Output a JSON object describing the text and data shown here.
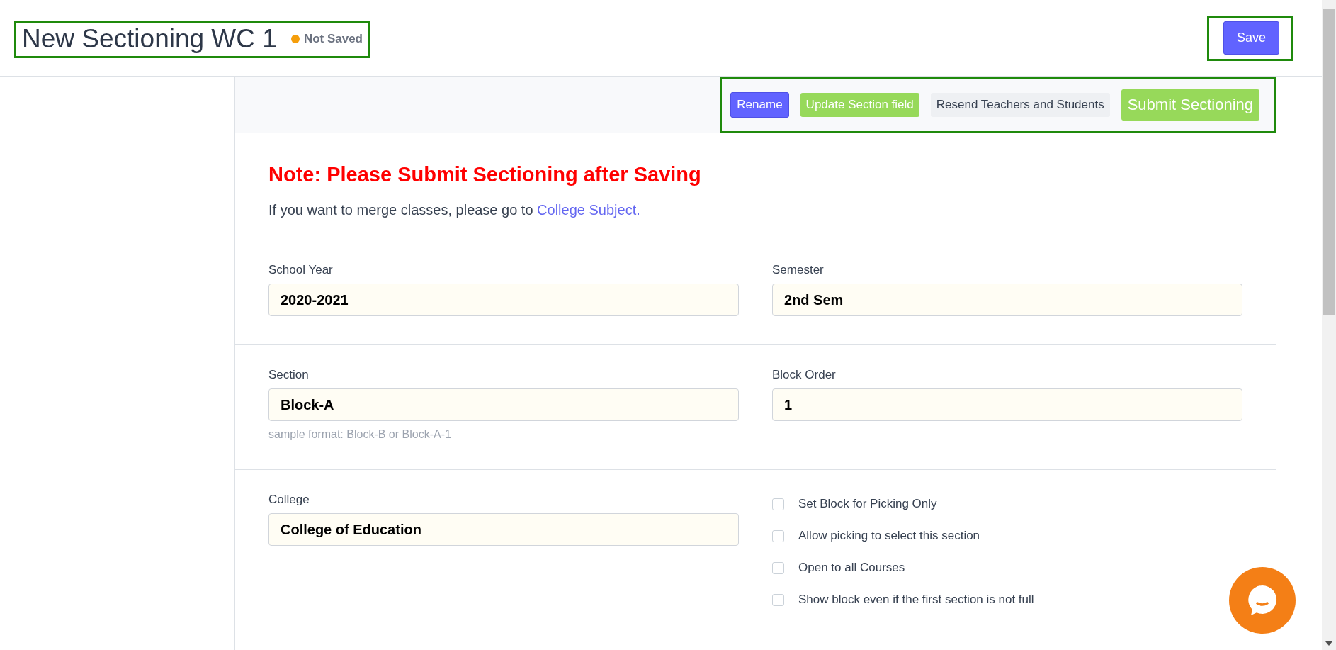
{
  "header": {
    "title": "New Sectioning WC 1",
    "status": {
      "label": "Not Saved",
      "color": "#f59e0b"
    },
    "save_button": "Save"
  },
  "toolbar": {
    "buttons": [
      {
        "label": "Rename",
        "kind": "primary"
      },
      {
        "label": "Update Section field",
        "kind": "success"
      },
      {
        "label": "Resend Teachers and Students",
        "kind": "light"
      },
      {
        "label": "Submit Sectioning",
        "kind": "large-success"
      }
    ]
  },
  "note": {
    "heading": "Note: Please Submit Sectioning after Saving",
    "text": "If you want to merge classes, please go to ",
    "link": "College Subject."
  },
  "rows": [
    {
      "fields": [
        {
          "label": "School Year",
          "value": "2020-2021"
        },
        {
          "label": "Semester",
          "value": "2nd Sem"
        }
      ]
    },
    {
      "fields": [
        {
          "label": "Section",
          "value": "Block-A",
          "hint": "sample format: Block-B or Block-A-1"
        },
        {
          "label": "Block Order",
          "value": "1"
        }
      ]
    }
  ],
  "college": {
    "label": "College",
    "value": "College of Education"
  },
  "options": [
    {
      "label": "Set Block for Picking Only",
      "checked": false
    },
    {
      "label": "Allow picking to select this section",
      "checked": false
    },
    {
      "label": "Open to all Courses",
      "checked": false
    },
    {
      "label": "Show block even if the first section is not full",
      "checked": false
    }
  ]
}
